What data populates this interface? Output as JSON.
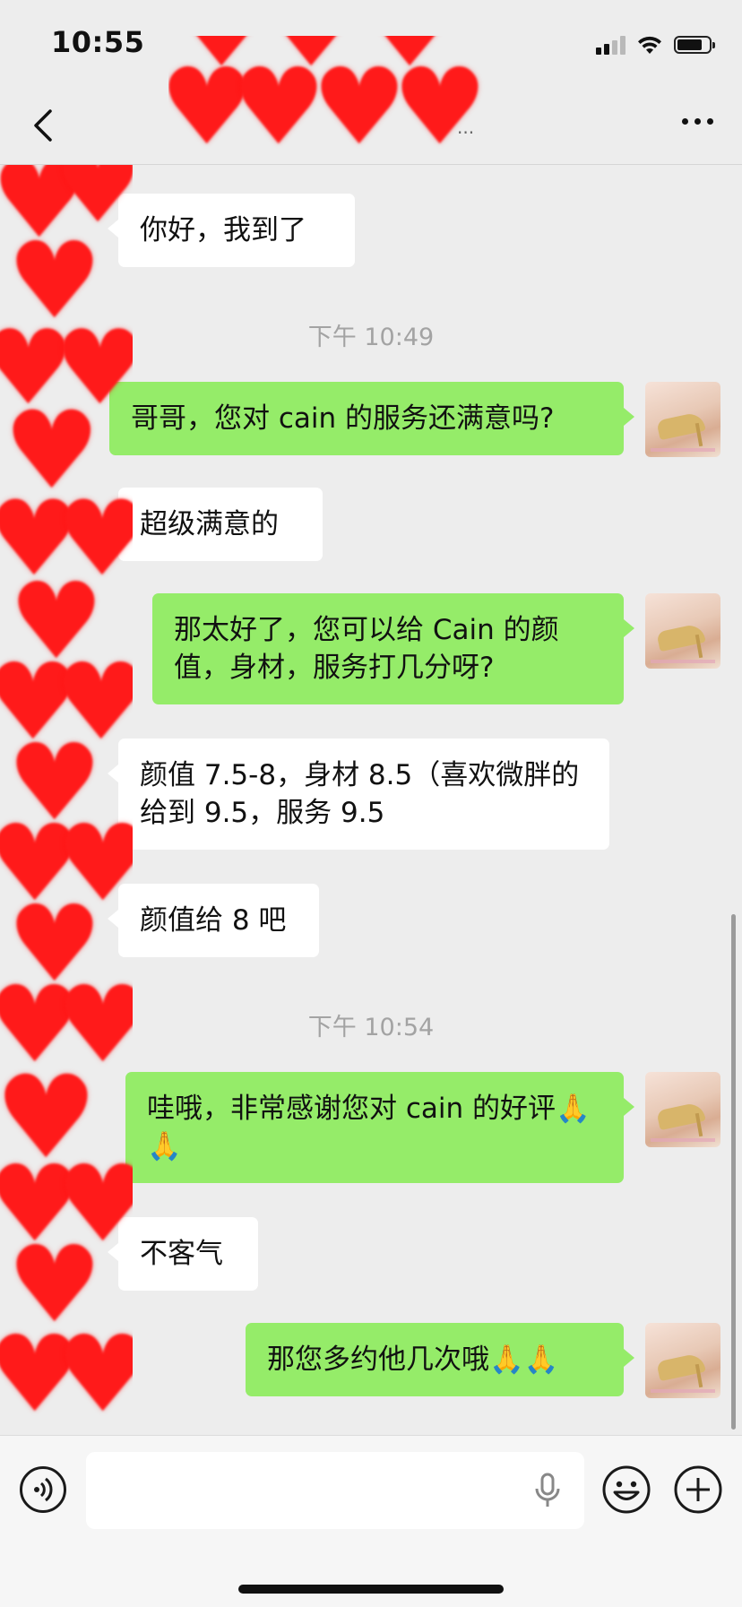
{
  "status_bar": {
    "time": "10:55",
    "signal_icon": "signal-icon",
    "wifi_icon": "wifi-icon",
    "battery_icon": "battery-icon"
  },
  "nav": {
    "back_icon": "chevron-left-icon",
    "title_suffix": "...",
    "more_icon": "more-dots-icon"
  },
  "messages": [
    {
      "side": "in",
      "text": "你好，我到了"
    },
    {
      "type": "timestamp",
      "text": "下午 10:49"
    },
    {
      "side": "out",
      "text": "哥哥，您对 cain 的服务还满意吗?"
    },
    {
      "side": "in",
      "text": "超级满意的"
    },
    {
      "side": "out",
      "text": "那太好了，您可以给 Cain 的颜值，身材，服务打几分呀?"
    },
    {
      "side": "in",
      "text": "颜值 7.5-8，身材 8.5（喜欢微胖的给到 9.5，服务 9.5"
    },
    {
      "side": "in",
      "text": "颜值给 8 吧"
    },
    {
      "type": "timestamp",
      "text": "下午 10:54"
    },
    {
      "side": "out",
      "text": "哇哦，非常感谢您对 cain 的好评🙏🙏"
    },
    {
      "side": "in",
      "text": "不客气"
    },
    {
      "side": "out",
      "text": "那您多约他几次哦🙏🙏"
    }
  ],
  "input_bar": {
    "voice_icon": "voice-icon",
    "mic_icon": "microphone-icon",
    "emoji_icon": "emoji-icon",
    "plus_icon": "plus-icon"
  },
  "colors": {
    "background": "#ededed",
    "outgoing_bubble": "#95ec69",
    "incoming_bubble": "#ffffff",
    "redaction_heart": "#ff1a1a"
  }
}
